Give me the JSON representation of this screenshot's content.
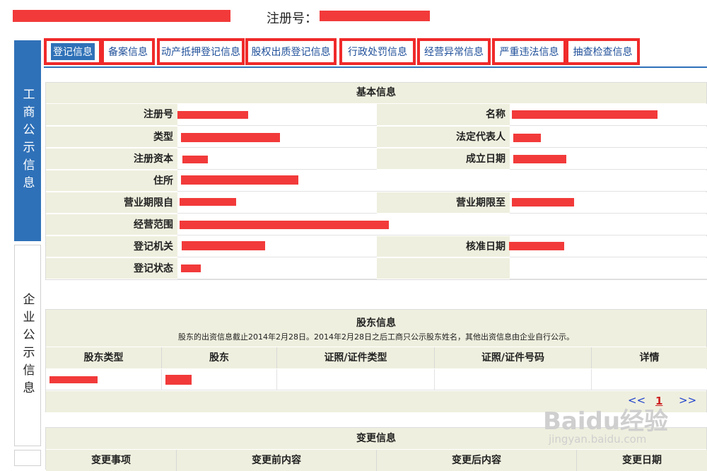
{
  "header": {
    "reg_label": "注册号："
  },
  "side_tabs": {
    "active": "工商公示信息",
    "inactive": "企业公示信息"
  },
  "tabs": [
    {
      "label": "登记信息"
    },
    {
      "label": "备案信息"
    },
    {
      "label": "动产抵押登记信息"
    },
    {
      "label": "股权出质登记信息"
    },
    {
      "label": "行政处罚信息"
    },
    {
      "label": "经营异常信息"
    },
    {
      "label": "严重违法信息"
    },
    {
      "label": "抽查检查信息"
    }
  ],
  "basic_info": {
    "title": "基本信息",
    "labels": {
      "reg_no": "注册号",
      "name": "名称",
      "type": "类型",
      "legal_rep": "法定代表人",
      "capital": "注册资本",
      "established": "成立日期",
      "address": "住所",
      "period_from": "营业期限自",
      "period_to": "营业期限至",
      "scope": "经营范围",
      "authority": "登记机关",
      "approval_date": "核准日期",
      "status": "登记状态"
    }
  },
  "shareholders": {
    "title": "股东信息",
    "note": "股东的出资信息截止2014年2月28日。2014年2月28日之后工商只公示股东姓名，其他出资信息由企业自行公示。",
    "columns": [
      "股东类型",
      "股东",
      "证照/证件类型",
      "证照/证件号码",
      "详情"
    ],
    "pager": {
      "prev": "<<",
      "page": "1",
      "next": ">>"
    }
  },
  "changes": {
    "title": "变更信息",
    "columns": [
      "变更事项",
      "变更前内容",
      "变更后内容",
      "变更日期"
    ]
  },
  "watermark": {
    "brand": "Baidu经验",
    "url": "jingyan.baidu.com"
  },
  "colors": {
    "accent": "#2f71b8",
    "highlight": "#f02a2a",
    "label_bg": "#efefdf"
  }
}
